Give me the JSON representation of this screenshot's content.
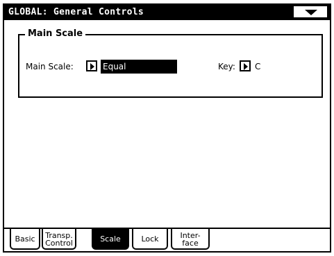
{
  "header": {
    "title": "GLOBAL: General Controls",
    "menu_icon": "triangle-down-icon"
  },
  "main_scale_group": {
    "title": "Main Scale",
    "main_scale_label": "Main Scale:",
    "main_scale_value": "Equal",
    "key_label": "Key:",
    "key_value": "C"
  },
  "tabs": [
    {
      "line1": "Basic",
      "line2": "",
      "active": false
    },
    {
      "line1": "Transp.",
      "line2": "Control",
      "active": false
    },
    {
      "line1": "Scale",
      "line2": "",
      "active": true
    },
    {
      "line1": "Lock",
      "line2": "",
      "active": false
    },
    {
      "line1": "Inter-",
      "line2": "face",
      "active": false
    }
  ]
}
